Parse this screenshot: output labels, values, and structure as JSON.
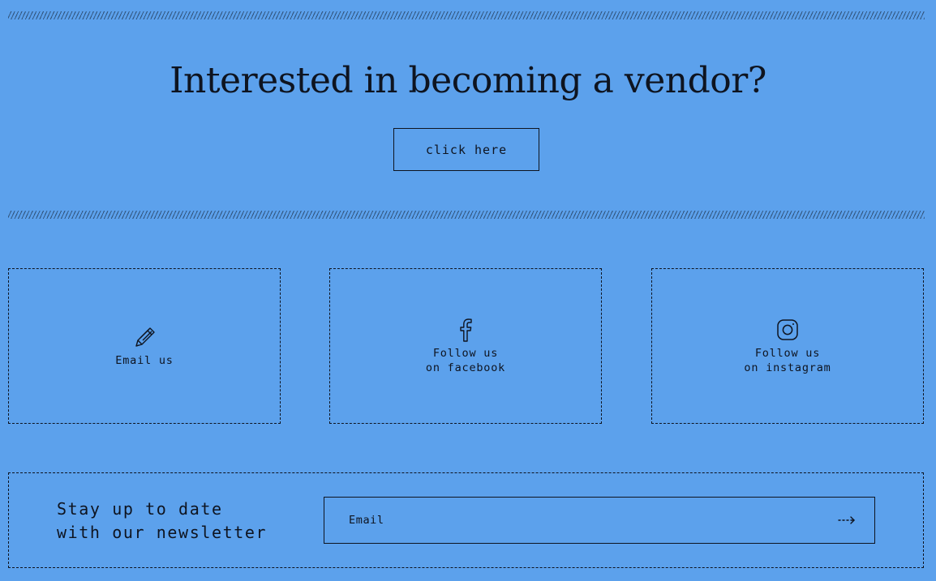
{
  "vendor": {
    "headline": "Interested in becoming a vendor?",
    "button_label": "click here"
  },
  "contact": {
    "email": {
      "icon": "pencil-icon",
      "label_line1": "Email us"
    },
    "facebook": {
      "icon": "facebook-icon",
      "label_line1": "Follow us",
      "label_line2": "on facebook"
    },
    "instagram": {
      "icon": "instagram-icon",
      "label_line1": "Follow us",
      "label_line2": "on instagram"
    }
  },
  "newsletter": {
    "title_line1": "Stay up to date",
    "title_line2": "with our newsletter",
    "email_placeholder": "Email",
    "submit_icon": "arrow-right-icon"
  },
  "colors": {
    "background": "#5ca1ec",
    "ink": "#0e1420"
  }
}
